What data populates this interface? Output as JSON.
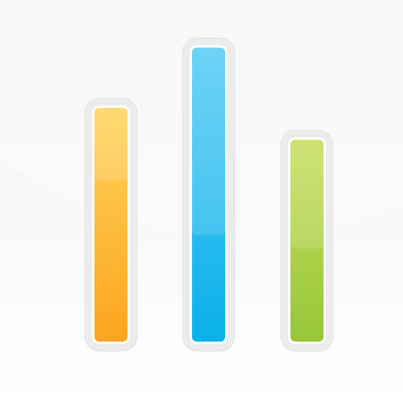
{
  "icon": {
    "name": "bar-chart-icon",
    "bars": [
      {
        "level": 0.66,
        "color_top": "#ffd45c",
        "color_bottom": "#fba51f"
      },
      {
        "level": 0.83,
        "color_top": "#56ccf6",
        "color_bottom": "#0bb0ea"
      },
      {
        "level": 0.57,
        "color_top": "#c7de5c",
        "color_bottom": "#97c63a"
      }
    ],
    "background_color": "#f5f5f5",
    "tray_color": "#ececec"
  }
}
